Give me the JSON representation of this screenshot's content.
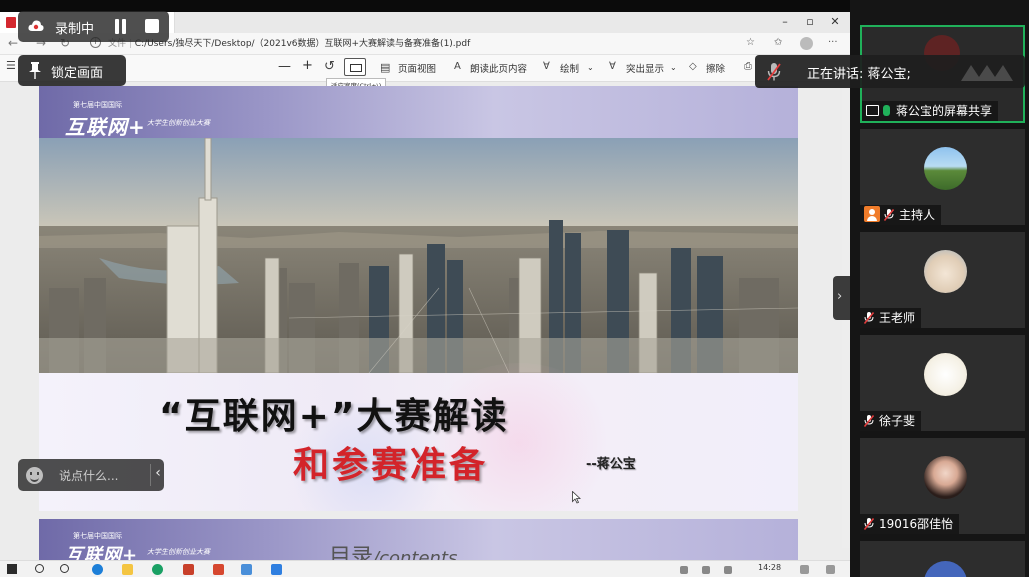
{
  "recording": {
    "label": "录制中"
  },
  "lock_screen": {
    "label": "锁定画面"
  },
  "chat_box": {
    "placeholder": "说点什么..."
  },
  "browser": {
    "address": "C:/Users/独尽天下/Desktop/（2021v6数据）互联网+大赛解读与备赛准备(1).pdf",
    "address_prefix": "文件"
  },
  "pdf_toolbar": {
    "zoom_out": "—",
    "zoom_in": "+",
    "page_view": "页面视图",
    "read_aloud": "朗读此页内容",
    "draw": "绘制",
    "highlight": "突出显示",
    "erase": "擦除",
    "fit_tooltip": "适应宽度(Ctrl+\\)"
  },
  "slide1": {
    "brand_small": "第七届中国国际",
    "brand_big": "互联网+",
    "brand_sub": "大学生创新创业大赛",
    "title_line1": "“互联网+”大赛解读",
    "title_line2": "和参赛准备",
    "presenter": "--蒋公宝"
  },
  "slide2": {
    "brand_small": "第七届中国国际",
    "brand_big": "互联网+",
    "brand_sub": "大学生创新创业大赛",
    "toc": "目录",
    "toc_en": "/contents"
  },
  "meeting": {
    "speaking_label": "正在讲话: 蒋公宝;",
    "participants": [
      {
        "name": "蒋公宝的屏幕共享",
        "role": "share"
      },
      {
        "name": "主持人",
        "role": "host"
      },
      {
        "name": "王老师",
        "role": "member"
      },
      {
        "name": "徐子斐",
        "role": "member"
      },
      {
        "name": "19016邵佳怡",
        "role": "member"
      }
    ]
  },
  "taskbar": {
    "time": "14:28"
  },
  "colors": {
    "accent_green": "#20b15a",
    "title_red": "#d3242a",
    "mute_red": "#e23c3c",
    "host_orange": "#f07c2a"
  }
}
